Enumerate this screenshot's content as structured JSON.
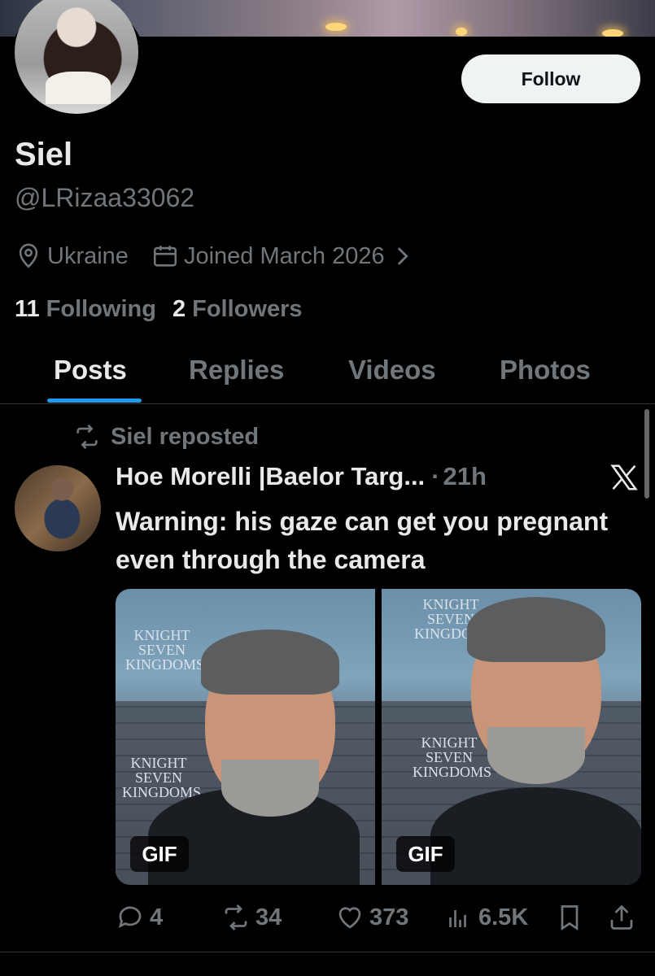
{
  "profile": {
    "name": "Siel",
    "handle": "@LRizaa33062",
    "location": "Ukraine",
    "joined": "Joined March 2026",
    "following_count": "11",
    "following_label": "Following",
    "followers_count": "2",
    "followers_label": "Followers",
    "follow_button": "Follow"
  },
  "tabs": [
    {
      "label": "Posts",
      "active": true
    },
    {
      "label": "Replies",
      "active": false
    },
    {
      "label": "Videos",
      "active": false
    },
    {
      "label": "Photos",
      "active": false
    }
  ],
  "post": {
    "repost_label": "Siel reposted",
    "author": "Hoe Morelli |Baelor Targ...",
    "separator": "·",
    "time": "21h",
    "text": "Warning: his gaze can get you pregnant even through the camera",
    "media": [
      {
        "badge": "GIF"
      },
      {
        "badge": "GIF"
      }
    ],
    "stats": {
      "replies": "4",
      "reposts": "34",
      "likes": "373",
      "views": "6.5K"
    }
  },
  "colors": {
    "accent": "#1d9bf0",
    "muted": "#71767b",
    "text": "#e7e9ea",
    "background": "#000000"
  },
  "icons": [
    "location-icon",
    "calendar-icon",
    "chevron-right-icon",
    "repost-icon",
    "x-logo-icon",
    "reply-icon",
    "like-icon",
    "views-icon",
    "bookmark-icon",
    "share-icon"
  ]
}
